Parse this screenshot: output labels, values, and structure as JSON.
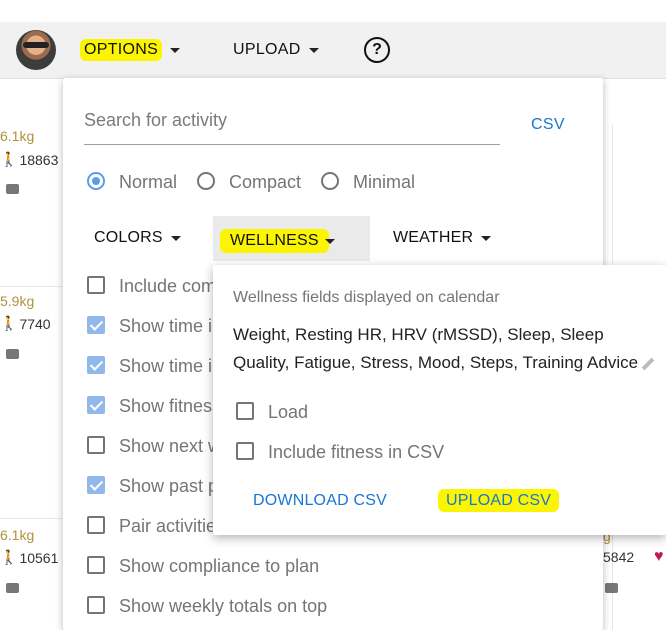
{
  "header": {
    "options_label": "OPTIONS",
    "upload_label": "UPLOAD",
    "help_symbol": "?"
  },
  "calendar_bg": {
    "cells": [
      {
        "weight": "6.1kg",
        "steps": "18863"
      },
      {
        "weight": "5.9kg",
        "steps": "7740"
      },
      {
        "weight": "6.1kg",
        "steps": "10561"
      }
    ],
    "right_fragment_steps": "5842",
    "right_fragment_weight": "g"
  },
  "options": {
    "search_placeholder": "Search for activity",
    "csv_label": "CSV",
    "view_modes": [
      {
        "label": "Normal",
        "selected": true
      },
      {
        "label": "Compact",
        "selected": false
      },
      {
        "label": "Minimal",
        "selected": false
      }
    ],
    "submenus": {
      "colors": "COLORS",
      "wellness": "WELLNESS",
      "weather": "WEATHER"
    },
    "checkboxes": [
      {
        "label": "Include com",
        "checked": false
      },
      {
        "label": "Show time in",
        "checked": true
      },
      {
        "label": "Show time in",
        "checked": true
      },
      {
        "label": "Show fitness",
        "checked": true
      },
      {
        "label": "Show next w",
        "checked": false
      },
      {
        "label": "Show past p",
        "checked": true
      },
      {
        "label": "Pair activitie",
        "checked": false
      },
      {
        "label": "Show compliance to plan",
        "checked": false
      },
      {
        "label": "Show weekly totals on top",
        "checked": false
      }
    ]
  },
  "wellness_popup": {
    "title": "Wellness fields displayed on calendar",
    "fields_text": "Weight, Resting HR, HRV (rMSSD), Sleep, Sleep Quality, Fatigue, Stress, Mood, Steps, Training Advice",
    "checkboxes": [
      {
        "label": "Load",
        "checked": false
      },
      {
        "label": "Include fitness in CSV",
        "checked": false
      }
    ],
    "download_label": "DOWNLOAD CSV",
    "upload_label": "UPLOAD CSV"
  },
  "colors": {
    "highlight": "#fbf600",
    "link": "#1976d2",
    "checkbox_checked": "#90b8ea",
    "radio_selected": "#5c9be8",
    "weight_text": "#b0923a"
  }
}
